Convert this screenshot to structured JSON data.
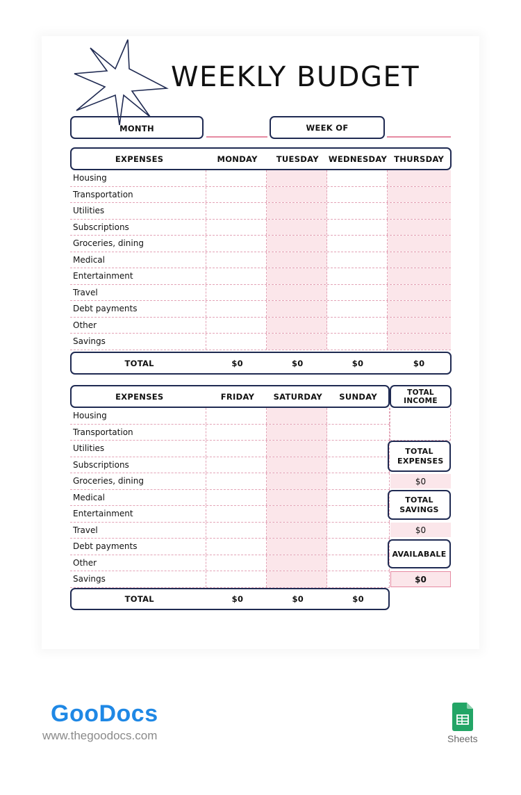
{
  "title": "WEEKLY BUDGET",
  "fields": {
    "month_label": "MONTH",
    "month_value": "",
    "week_of_label": "WEEK OF",
    "week_of_value": ""
  },
  "table1": {
    "headers": [
      "EXPENSES",
      "MONDAY",
      "TUESDAY",
      "WEDNESDAY",
      "THURSDAY"
    ],
    "rows": [
      "Housing",
      "Transportation",
      "Utilities",
      "Subscriptions",
      "Groceries, dining",
      "Medical",
      "Entertainment",
      "Travel",
      "Debt payments",
      "Other",
      "Savings"
    ],
    "total_label": "TOTAL",
    "totals": [
      "$0",
      "$0",
      "$0",
      "$0"
    ]
  },
  "table2": {
    "headers": [
      "EXPENSES",
      "FRIDAY",
      "SATURDAY",
      "SUNDAY"
    ],
    "rows": [
      "Housing",
      "Transportation",
      "Utilities",
      "Subscriptions",
      "Groceries, dining",
      "Medical",
      "Entertainment",
      "Travel",
      "Debt payments",
      "Other",
      "Savings"
    ],
    "total_label": "TOTAL",
    "totals": [
      "$0",
      "$0",
      "$0"
    ]
  },
  "summary": {
    "total_income_label": "TOTAL INCOME",
    "total_income_value": "",
    "total_expenses_label": "TOTAL EXPENSES",
    "total_expenses_value": "$0",
    "total_savings_label": "TOTAL SAVINGS",
    "total_savings_value": "$0",
    "available_label": "AVAILABALE",
    "available_value": "$0"
  },
  "branding": {
    "logo": "GooDocs",
    "website": "www.thegoodocs.com",
    "app_label": "Sheets"
  },
  "colors": {
    "navy": "#1f2a52",
    "pink_fill": "#fbe6ea",
    "pink_line": "#e68aa2",
    "logo_blue": "#1f88e5",
    "sheets_green": "#23a566"
  }
}
